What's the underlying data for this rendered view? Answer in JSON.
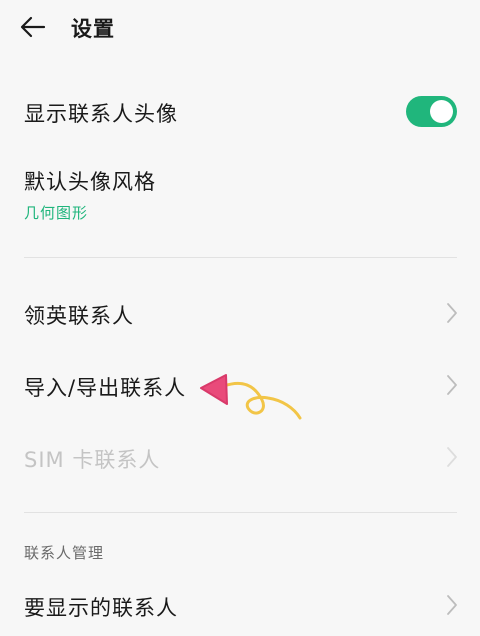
{
  "header": {
    "title": "设置",
    "back_icon": "arrow-left-icon"
  },
  "settings": {
    "show_avatar": {
      "label": "显示联系人头像",
      "enabled": true
    },
    "avatar_style": {
      "label": "默认头像风格",
      "value": "几何图形"
    },
    "linkedin": {
      "label": "领英联系人"
    },
    "import_export": {
      "label": "导入/导出联系人"
    },
    "sim": {
      "label": "SIM 卡联系人",
      "disabled": true
    }
  },
  "section_contacts": {
    "title": "联系人管理",
    "item_partial": {
      "label": "要显示的联系人"
    }
  },
  "colors": {
    "accent": "#20b67c",
    "annotation": "#e94a7a",
    "annotation_tail": "#f2c547"
  },
  "annotation_icon": "hand-drawn-arrow-icon"
}
